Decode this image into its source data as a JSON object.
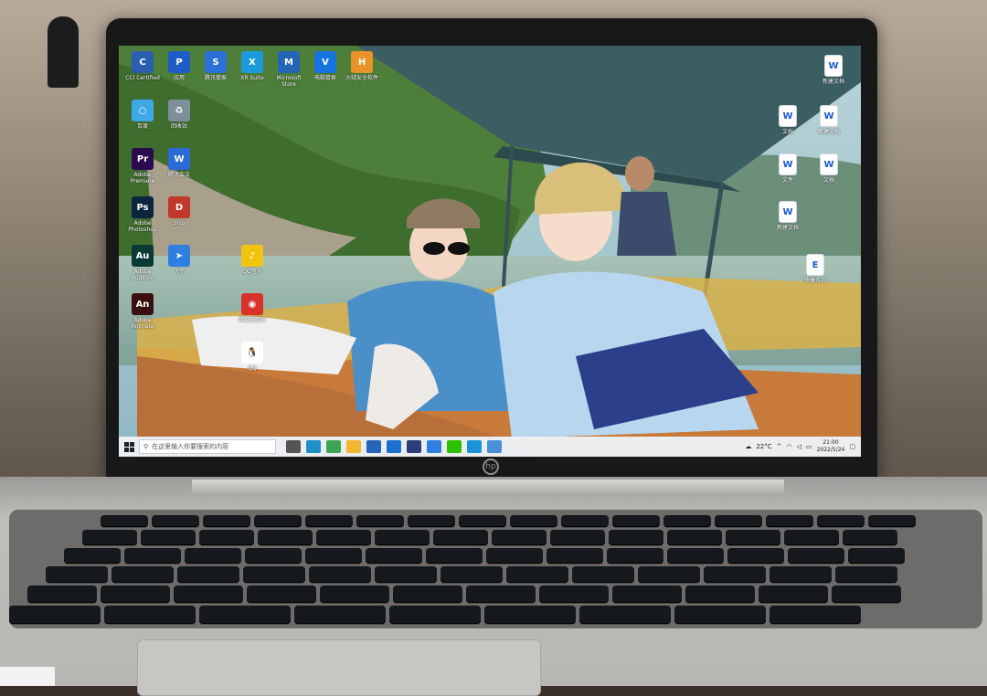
{
  "desktop": {
    "icons": [
      {
        "label": "CCI Certified",
        "glyph": "C",
        "color": "#2a5fb0",
        "col": 0,
        "row": 0
      },
      {
        "label": "应用",
        "glyph": "P",
        "color": "#1e5cc8",
        "col": 1,
        "row": 0
      },
      {
        "label": "腾讯管家",
        "glyph": "S",
        "color": "#2b70d8",
        "col": 2,
        "row": 0
      },
      {
        "label": "XR Suite",
        "glyph": "X",
        "color": "#1a9ad6",
        "col": 3,
        "row": 0
      },
      {
        "label": "Microsoft Store",
        "glyph": "M",
        "color": "#2465b8",
        "col": 4,
        "row": 0
      },
      {
        "label": "电脑管家",
        "glyph": "V",
        "color": "#1674e0",
        "col": 5,
        "row": 0
      },
      {
        "label": "火绒安全软件",
        "glyph": "H",
        "color": "#e9932a",
        "col": 6,
        "row": 0
      },
      {
        "label": "百度",
        "glyph": "○",
        "color": "#3fa9e8",
        "col": 0,
        "row": 1
      },
      {
        "label": "回收站",
        "glyph": "♻",
        "color": "#7f8f99",
        "col": 1,
        "row": 1
      },
      {
        "label": "Adobe Premiere",
        "glyph": "Pr",
        "color": "#2b0a4f",
        "col": 0,
        "row": 2
      },
      {
        "label": "腾讯会议",
        "glyph": "W",
        "color": "#2a6bd8",
        "col": 1,
        "row": 2
      },
      {
        "label": "Adobe Photoshop",
        "glyph": "Ps",
        "color": "#0b2540",
        "col": 0,
        "row": 3
      },
      {
        "label": "Snip",
        "glyph": "D",
        "color": "#c0392b",
        "col": 1,
        "row": 3
      },
      {
        "label": "Adobe Audition",
        "glyph": "Au",
        "color": "#0a3a34",
        "col": 0,
        "row": 4
      },
      {
        "label": "飞书",
        "glyph": "➤",
        "color": "#2f7fe0",
        "col": 1,
        "row": 4
      },
      {
        "label": "QQ音乐",
        "glyph": "♪",
        "color": "#f1c40f",
        "col": 3,
        "row": 4
      },
      {
        "label": "Adobe Animate",
        "glyph": "An",
        "color": "#3a0f0f",
        "col": 0,
        "row": 5
      },
      {
        "label": "网易云音乐",
        "glyph": "◉",
        "color": "#d9312b",
        "col": 3,
        "row": 5
      },
      {
        "label": "QQ",
        "glyph": "🐧",
        "color": "#ffffff",
        "col": 3,
        "row": 6
      }
    ],
    "right_icons": [
      {
        "label": "新建文档",
        "glyph": "W"
      },
      {
        "label": "文档",
        "glyph": "W"
      },
      {
        "label": "新建文档",
        "glyph": "W"
      },
      {
        "label": "文件",
        "glyph": "W"
      },
      {
        "label": "文档",
        "glyph": "W"
      },
      {
        "label": "新建文档",
        "glyph": "W"
      },
      {
        "label": "快捷方式",
        "glyph": "E"
      }
    ]
  },
  "taskbar": {
    "search_placeholder": "在这里输入你要搜索的内容",
    "start_icon": "windows-icon",
    "apps": [
      {
        "name": "task-view",
        "color": "#555"
      },
      {
        "name": "edge",
        "color": "#1e90c8"
      },
      {
        "name": "chrome",
        "color": "#3aa655"
      },
      {
        "name": "explorer",
        "color": "#f2b632"
      },
      {
        "name": "store",
        "color": "#2465b8"
      },
      {
        "name": "mail",
        "color": "#1a6fd0"
      },
      {
        "name": "calendar",
        "color": "#2b3e7a"
      },
      {
        "name": "feishu",
        "color": "#2f7fe0"
      },
      {
        "name": "wechat",
        "color": "#2dc100"
      },
      {
        "name": "qq",
        "color": "#1a93d8"
      },
      {
        "name": "photos",
        "color": "#4a90d9"
      }
    ],
    "weather": "22°C",
    "time": "21:00",
    "date": "2022/5/24"
  },
  "colors": {
    "sky": "#8fb8c4",
    "foliage": "#4e7f3a",
    "river": "#9cb3a8",
    "boat_wood": "#c87a3a",
    "canopy": "#3b5e63"
  }
}
